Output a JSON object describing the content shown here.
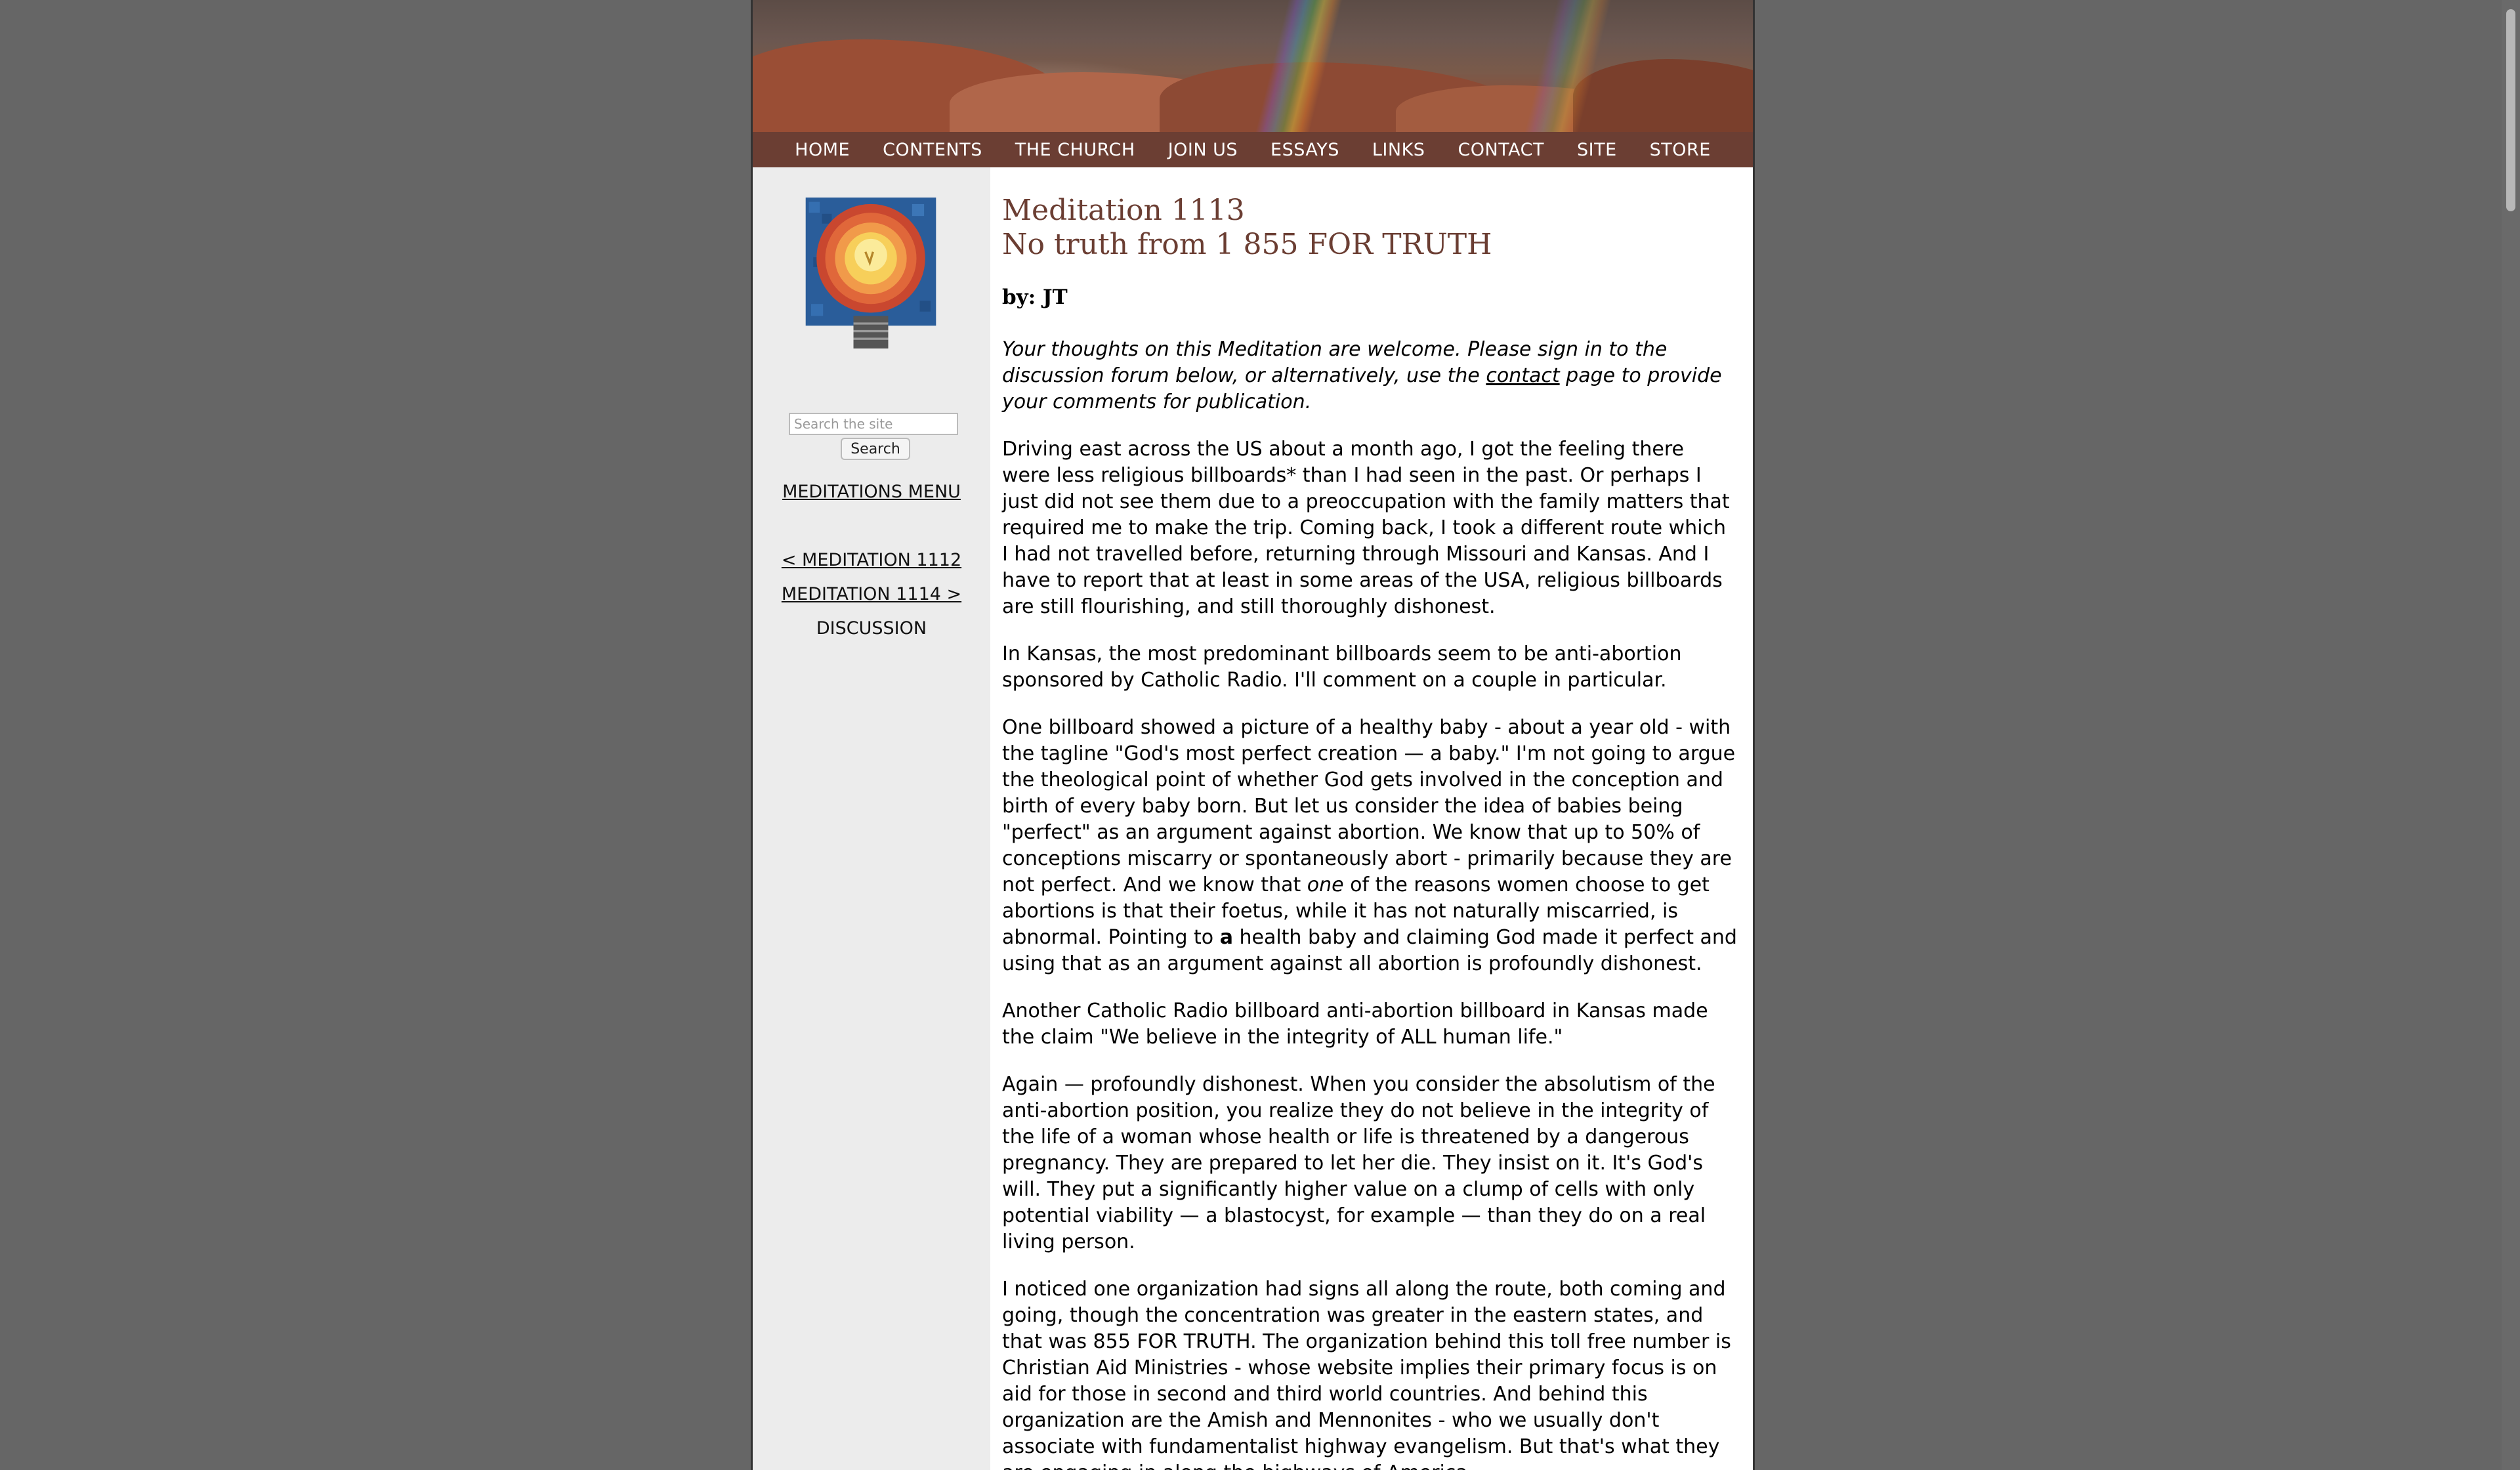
{
  "nav": {
    "items": [
      "HOME",
      "CONTENTS",
      "THE CHURCH",
      "JOIN US",
      "ESSAYS",
      "LINKS",
      "CONTACT",
      "SITE",
      "STORE"
    ]
  },
  "sidebar": {
    "search": {
      "placeholder": "Search the site",
      "button_label": "Search"
    },
    "meditations_menu": "MEDITATIONS MENU",
    "prev_link": "< MEDITATION 1112",
    "next_link": "MEDITATION 1114 >",
    "discussion": "DISCUSSION"
  },
  "article": {
    "title_line1": "Meditation 1113",
    "title_line2": "No truth from 1 855 FOR TRUTH",
    "byline": "by: JT",
    "intro_before": "Your thoughts on this Meditation are welcome. Please sign in to the discussion forum below, or alternatively, use the ",
    "intro_link": "contact",
    "intro_after": " page to provide your comments for publication.",
    "p1": "Driving east across the US about a month ago, I got the feeling there were less religious billboards* than I had seen in the past. Or perhaps I just did not see them due to a preoccupation with the family matters that required me to make the trip. Coming back, I took a different route which I had not travelled before, returning through Missouri and Kansas. And I have to report that at least in some areas of the USA, religious billboards are still flourishing, and still thoroughly dishonest.",
    "p2": "In Kansas, the most predominant billboards seem to be anti-abortion sponsored by Catholic Radio. I'll comment on a couple in particular.",
    "p3_a": "One billboard showed a picture of a healthy baby - about a year old - with the tagline \"God's most perfect creation — a baby.\" I'm not going to argue the theological point of whether God gets involved in the conception and birth of every baby born. But let us consider the idea of babies being \"perfect\" as an argument against abortion. We know that up to 50% of conceptions miscarry or spontaneously abort - primarily because they are not perfect. And we know that ",
    "p3_em": "one",
    "p3_b": " of the reasons women choose to get abortions is that their foetus, while it has not naturally miscarried, is abnormal. Pointing to ",
    "p3_strong": "a",
    "p3_c": " health baby and claiming God made it perfect and using that as an argument against all abortion is profoundly dishonest.",
    "p4": "Another Catholic Radio billboard anti-abortion billboard in Kansas made the claim \"We believe in the integrity of ALL human life.\"",
    "p5": "Again — profoundly dishonest. When you consider the absolutism of the anti-abortion position, you realize they do not believe in the integrity of the life of a woman whose health or life is threatened by a dangerous pregnancy. They are prepared to let her die. They insist on it. It's God's will. They put a significantly higher value on a clump of cells with only potential viability — a blastocyst, for example — than they do on a real living person.",
    "p6": "I noticed one organization had signs all along the route, both coming and going, though the concentration was greater in the eastern states, and that was 855 FOR TRUTH. The organization behind this toll free number is Christian Aid Ministries - whose website implies their primary focus is on aid for those in second and third world countries. And behind this organization are the Amish and Mennonites - who we usually don't associate with fundamentalist highway evangelism. But that's what they are engaging in along the highways of America."
  },
  "colors": {
    "background": "#666666",
    "nav_bar": "#6b3e33",
    "title": "#6b3e33",
    "sidebar": "#ececec"
  }
}
